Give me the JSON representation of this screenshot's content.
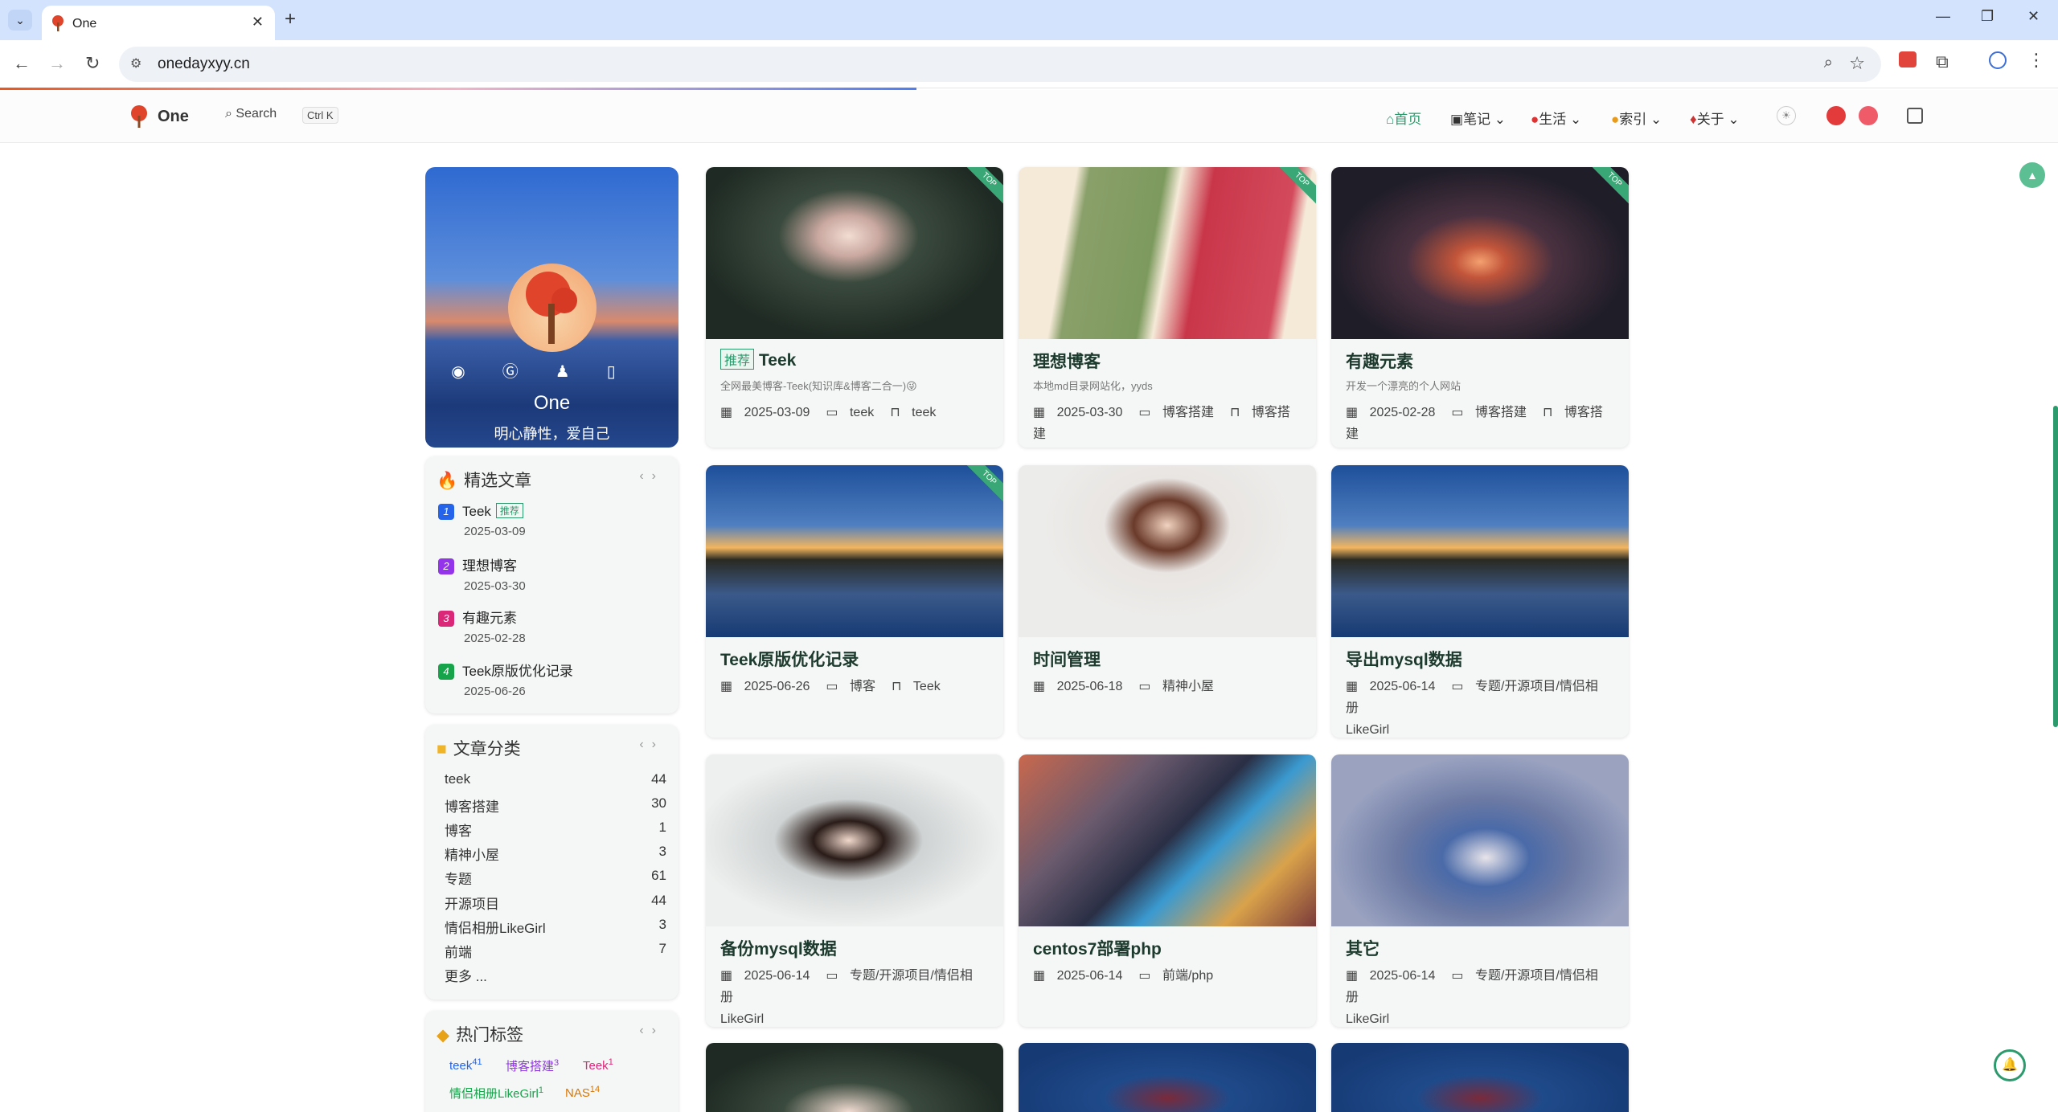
{
  "browser": {
    "tab_title": "One",
    "url": "onedayxyy.cn"
  },
  "site": {
    "brand": "One",
    "search_label": "Search",
    "search_shortcut": "Ctrl K",
    "menu": [
      {
        "label": "首页",
        "icon": "home-icon"
      },
      {
        "label": "笔记",
        "icon": "book-icon"
      },
      {
        "label": "生活",
        "icon": "life-icon"
      },
      {
        "label": "索引",
        "icon": "index-icon"
      },
      {
        "label": "关于",
        "icon": "about-icon"
      }
    ]
  },
  "profile": {
    "name": "One",
    "motto": "明心静性，爱自己"
  },
  "featured": {
    "title": "精选文章",
    "items": [
      {
        "num": "1",
        "title": "Teek",
        "badge": "推荐",
        "date": "2025-03-09",
        "color": "#2563eb"
      },
      {
        "num": "2",
        "title": "理想博客",
        "date": "2025-03-30",
        "color": "#9333ea"
      },
      {
        "num": "3",
        "title": "有趣元素",
        "date": "2025-02-28",
        "color": "#db2777"
      },
      {
        "num": "4",
        "title": "Teek原版优化记录",
        "date": "2025-06-26",
        "color": "#16a34a"
      }
    ]
  },
  "categories": {
    "title": "文章分类",
    "items": [
      {
        "name": "teek",
        "count": "44"
      },
      {
        "name": "博客搭建",
        "count": "30"
      },
      {
        "name": "博客",
        "count": "1"
      },
      {
        "name": "精神小屋",
        "count": "3"
      },
      {
        "name": "专题",
        "count": "61"
      },
      {
        "name": "开源项目",
        "count": "44"
      },
      {
        "name": "情侣相册LikeGirl",
        "count": "3"
      },
      {
        "name": "前端",
        "count": "7"
      }
    ],
    "more": "更多 ..."
  },
  "tags": {
    "title": "热门标签",
    "items": [
      {
        "name": "teek",
        "count": "41",
        "color": "#2563eb"
      },
      {
        "name": "博客搭建",
        "count": "3",
        "color": "#9333ea"
      },
      {
        "name": "Teek",
        "count": "1",
        "color": "#db2777"
      },
      {
        "name": "情侣相册LikeGirl",
        "count": "1",
        "color": "#16a34a"
      },
      {
        "name": "NAS",
        "count": "14",
        "color": "#d97706"
      }
    ]
  },
  "articles": [
    {
      "title": "Teek",
      "badge": "推荐",
      "desc": "全网最美博客-Teek(知识库&博客二合一)😜",
      "date": "2025-03-09",
      "cat": "teek",
      "tag": "teek",
      "top": "TOP"
    },
    {
      "title": "理想博客",
      "desc": "本地md目录网站化，yyds",
      "date": "2025-03-30",
      "cat": "博客搭建",
      "tag": "博客搭建",
      "top": "TOP"
    },
    {
      "title": "有趣元素",
      "desc": "开发一个漂亮的个人网站",
      "date": "2025-02-28",
      "cat": "博客搭建",
      "tag": "博客搭建",
      "top": "TOP"
    },
    {
      "title": "Teek原版优化记录",
      "date": "2025-06-26",
      "cat": "博客",
      "tag": "Teek",
      "top": "TOP"
    },
    {
      "title": "时间管理",
      "date": "2025-06-18",
      "cat": "精神小屋"
    },
    {
      "title": "导出mysql数据",
      "date": "2025-06-14",
      "cat": "专题/开源项目/情侣相册",
      "tag": "LikeGirl"
    },
    {
      "title": "备份mysql数据",
      "date": "2025-06-14",
      "cat": "专题/开源项目/情侣相册",
      "tag": "LikeGirl"
    },
    {
      "title": "centos7部署php",
      "date": "2025-06-14",
      "cat": "前端/php"
    },
    {
      "title": "其它",
      "date": "2025-06-14",
      "cat": "专题/开源项目/情侣相册",
      "tag": "LikeGirl"
    }
  ],
  "colors": {
    "accent": "#2c9a6c",
    "card_bg": "#f4f7f5"
  }
}
